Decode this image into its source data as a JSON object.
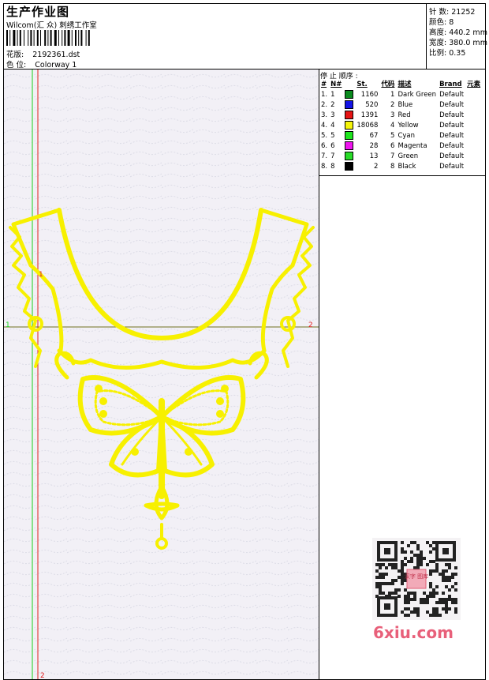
{
  "header": {
    "title": "生产作业图",
    "studio": "Wilcom(汇 众) 刺绣工作室",
    "pattern_label": "花版:",
    "pattern_value": "2192361.dst",
    "colorway_label": "色 位:",
    "colorway_value": "Colorway 1"
  },
  "stats": {
    "stitches": "针 数: 21252",
    "colors": "颜色: 8",
    "height": "高度: 440.2 mm",
    "width": "宽度: 380.0 mm",
    "scale": "比例: 0.35"
  },
  "stops": {
    "title": "停 止 顺序 :",
    "headers": [
      "#",
      "N#",
      "St.",
      "代码",
      "描述",
      "Brand",
      "元素"
    ],
    "rows": [
      {
        "idx": "1.",
        "n": "1",
        "color": "#0a8a1e",
        "st": "1160",
        "code": "1",
        "desc": "Dark Green",
        "brand": "Default"
      },
      {
        "idx": "2.",
        "n": "2",
        "color": "#1414e6",
        "st": "520",
        "code": "2",
        "desc": "Blue",
        "brand": "Default"
      },
      {
        "idx": "3.",
        "n": "3",
        "color": "#e61414",
        "st": "1391",
        "code": "3",
        "desc": "Red",
        "brand": "Default"
      },
      {
        "idx": "4.",
        "n": "4",
        "color": "#f5f50a",
        "st": "18068",
        "code": "4",
        "desc": "Yellow",
        "brand": "Default"
      },
      {
        "idx": "5.",
        "n": "5",
        "color": "#1ee61e",
        "st": "67",
        "code": "5",
        "desc": "Cyan",
        "brand": "Default"
      },
      {
        "idx": "6.",
        "n": "6",
        "color": "#f014f0",
        "st": "28",
        "code": "6",
        "desc": "Magenta",
        "brand": "Default"
      },
      {
        "idx": "7.",
        "n": "7",
        "color": "#28dc28",
        "st": "13",
        "code": "7",
        "desc": "Green",
        "brand": "Default"
      },
      {
        "idx": "8.",
        "n": "8",
        "color": "#000000",
        "st": "2",
        "code": "8",
        "desc": "Black",
        "brand": "Default"
      }
    ]
  },
  "axes": {
    "left_top": "1",
    "left_mid": "1",
    "right_mid": "2",
    "bottom": "2"
  },
  "watermark": "6xiu.com",
  "qr_badge": "汉字 图库"
}
